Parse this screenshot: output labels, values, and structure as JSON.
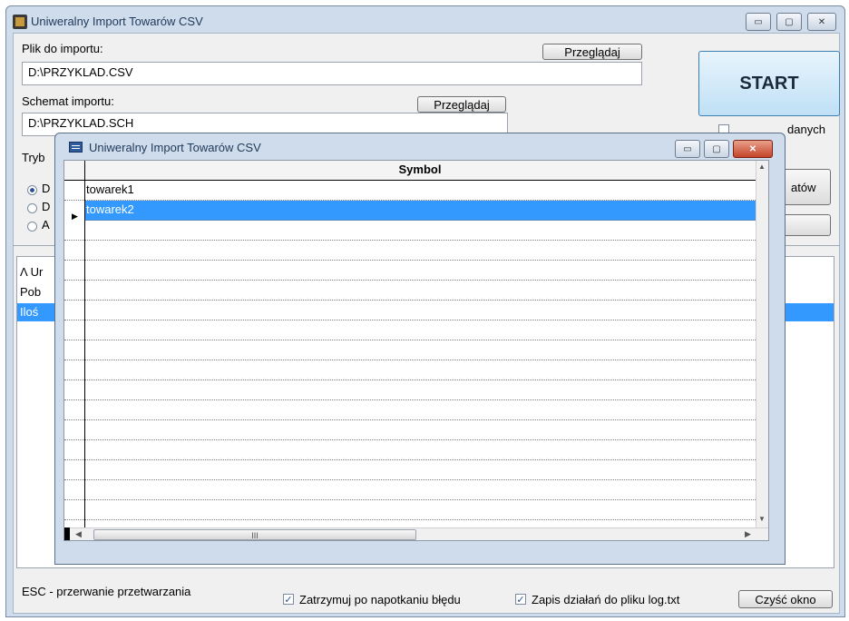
{
  "main_window": {
    "title": "Uniweralny Import Towarów  CSV",
    "controls": {
      "minimize": "▭",
      "maximize": "▢",
      "close": "✕"
    }
  },
  "import_file": {
    "label": "Plik do importu:",
    "value": "D:\\PRZYKLAD.CSV",
    "browse": "Przeglądaj"
  },
  "schema": {
    "label": "Schemat importu:",
    "value": "D:\\PRZYKLAD.SCH",
    "browse": "Przeglądaj"
  },
  "start_button": "START",
  "right_checkbox_label": "danych",
  "right_button_label": "atów",
  "mode_label": "Tryb",
  "radio_options": [
    "D",
    "D",
    "A"
  ],
  "log": {
    "lines": [
      "Λ Ur",
      "Pob",
      "Iloś"
    ]
  },
  "child_window": {
    "title": "Uniweralny Import Towarów  CSV",
    "grid": {
      "column_header": "Symbol",
      "rows": [
        "towarek1",
        "towarek2"
      ],
      "selected_index": 1
    },
    "hscroll_label": "III"
  },
  "footer": {
    "esc_hint": "ESC - przerwanie przetwarzania",
    "stop_on_error": "Zatrzymuj po napotkaniu błędu",
    "stop_on_error_checked": true,
    "log_to_file": "Zapis działań do pliku log.txt",
    "log_to_file_checked": true,
    "clear_button": "Czyść okno"
  },
  "colors": {
    "selection": "#3399ff",
    "window_frame": "#cfdcec",
    "close_red": "#c4442a"
  }
}
